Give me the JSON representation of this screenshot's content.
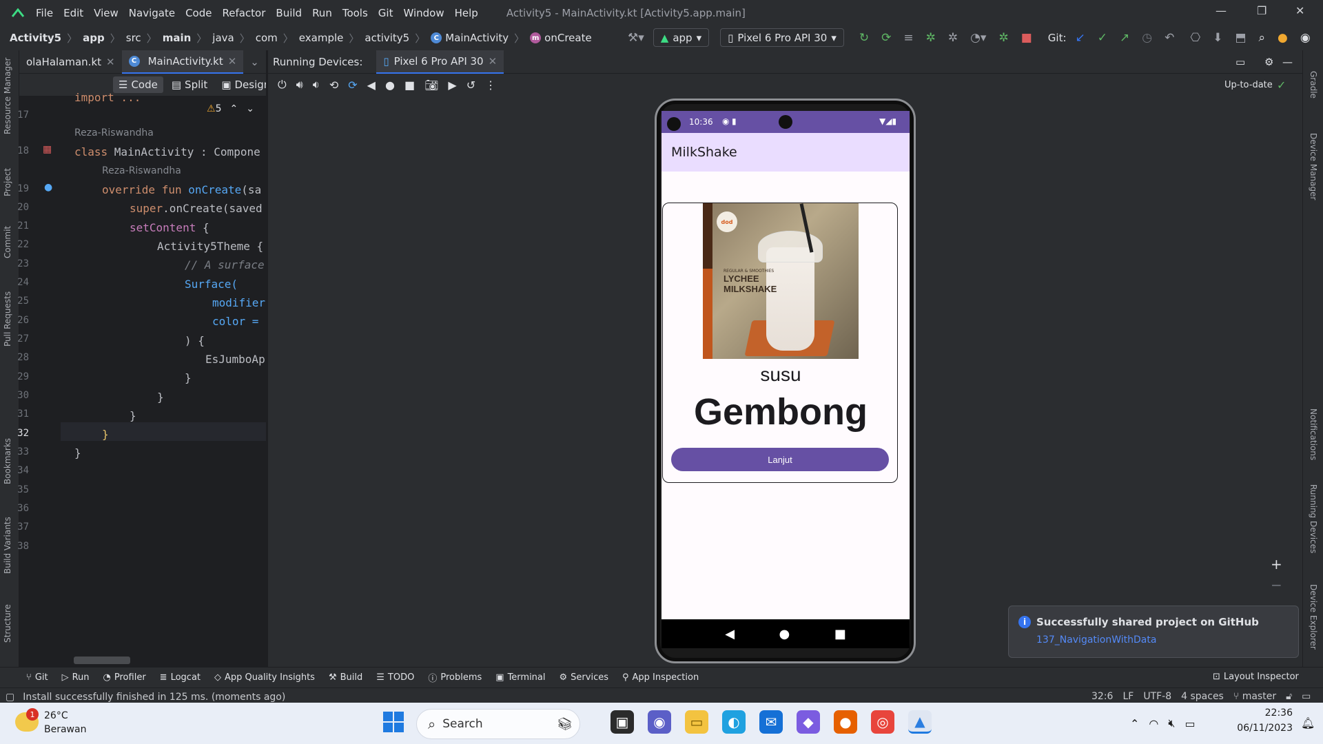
{
  "menubar": {
    "items": [
      "File",
      "Edit",
      "View",
      "Navigate",
      "Code",
      "Refactor",
      "Build",
      "Run",
      "Tools",
      "Git",
      "Window",
      "Help"
    ],
    "title": "Activity5 - MainActivity.kt [Activity5.app.main]"
  },
  "navbar": {
    "crumbs": [
      "Activity5",
      "app",
      "src",
      "main",
      "java",
      "com",
      "example",
      "activity5",
      "MainActivity",
      "onCreate"
    ],
    "run_config": "app",
    "device": "Pixel 6 Pro API 30",
    "git_label": "Git:"
  },
  "editor": {
    "tabs": [
      "olaHalaman.kt",
      "MainActivity.kt"
    ],
    "modes": [
      "Code",
      "Split",
      "Design"
    ],
    "warning_count": "5",
    "line_numbers": [
      "17",
      "18",
      "19",
      "20",
      "21",
      "22",
      "23",
      "24",
      "25",
      "26",
      "27",
      "28",
      "29",
      "30",
      "31",
      "32",
      "33",
      "34",
      "35",
      "36",
      "37",
      "38"
    ],
    "author1": "Reza-Riswandha",
    "author2": "Reza-Riswandha",
    "lines": {
      "import": "import ...",
      "l18a": "class ",
      "l18b": "MainActivity : Compone",
      "l19a": "override fun ",
      "l19b": "onCreate",
      "l19c": "(sa",
      "l20a": "super",
      "l20b": ".onCreate(saved",
      "l21a": "setContent",
      "l21b": " {",
      "l22a": "Activity5Theme",
      " l22b": " {",
      "l23": "// A surface",
      "l24": "Surface(",
      "l25": "modifier",
      "l26": "color =",
      "l27": ") {",
      "l28": "EsJumboAp",
      "l29": "}",
      "l30": "}",
      "l31": "}",
      "l32": "}",
      "l33": "}"
    }
  },
  "running_devices": {
    "label": "Running Devices:",
    "tab": "Pixel 6 Pro API 30",
    "status": "Up-to-date"
  },
  "phone": {
    "time": "10:36",
    "app_title": "MilkShake",
    "image_small_text": "REGULAR & SMOOTHIES",
    "image_title": "LYCHEE MILKSHAKE",
    "image_logo": "dod",
    "subtitle": "susu",
    "name": "Gembong",
    "button": "Lanjut"
  },
  "notification": {
    "title": "Successfully shared project on GitHub",
    "link": "137_NavigationWithData"
  },
  "tool_windows": [
    "Git",
    "Run",
    "Profiler",
    "Logcat",
    "App Quality Insights",
    "Build",
    "TODO",
    "Problems",
    "Terminal",
    "Services",
    "App Inspection"
  ],
  "layout_inspector": "Layout Inspector",
  "left_tools": [
    "Resource Manager",
    "Project",
    "Commit",
    "Pull Requests",
    "Bookmarks",
    "Build Variants",
    "Structure"
  ],
  "right_tools": [
    "Gradle",
    "Device Manager",
    "Notifications",
    "Running Devices",
    "Device Explorer"
  ],
  "status": {
    "message": "Install successfully finished in 125 ms. (moments ago)",
    "position": "32:6",
    "line_sep": "LF",
    "encoding": "UTF-8",
    "indent": "4 spaces",
    "branch": "master"
  },
  "taskbar": {
    "temp": "26°C",
    "weather": "Berawan",
    "weather_badge": "1",
    "search": "Search",
    "time": "22:36",
    "date": "06/11/2023"
  }
}
